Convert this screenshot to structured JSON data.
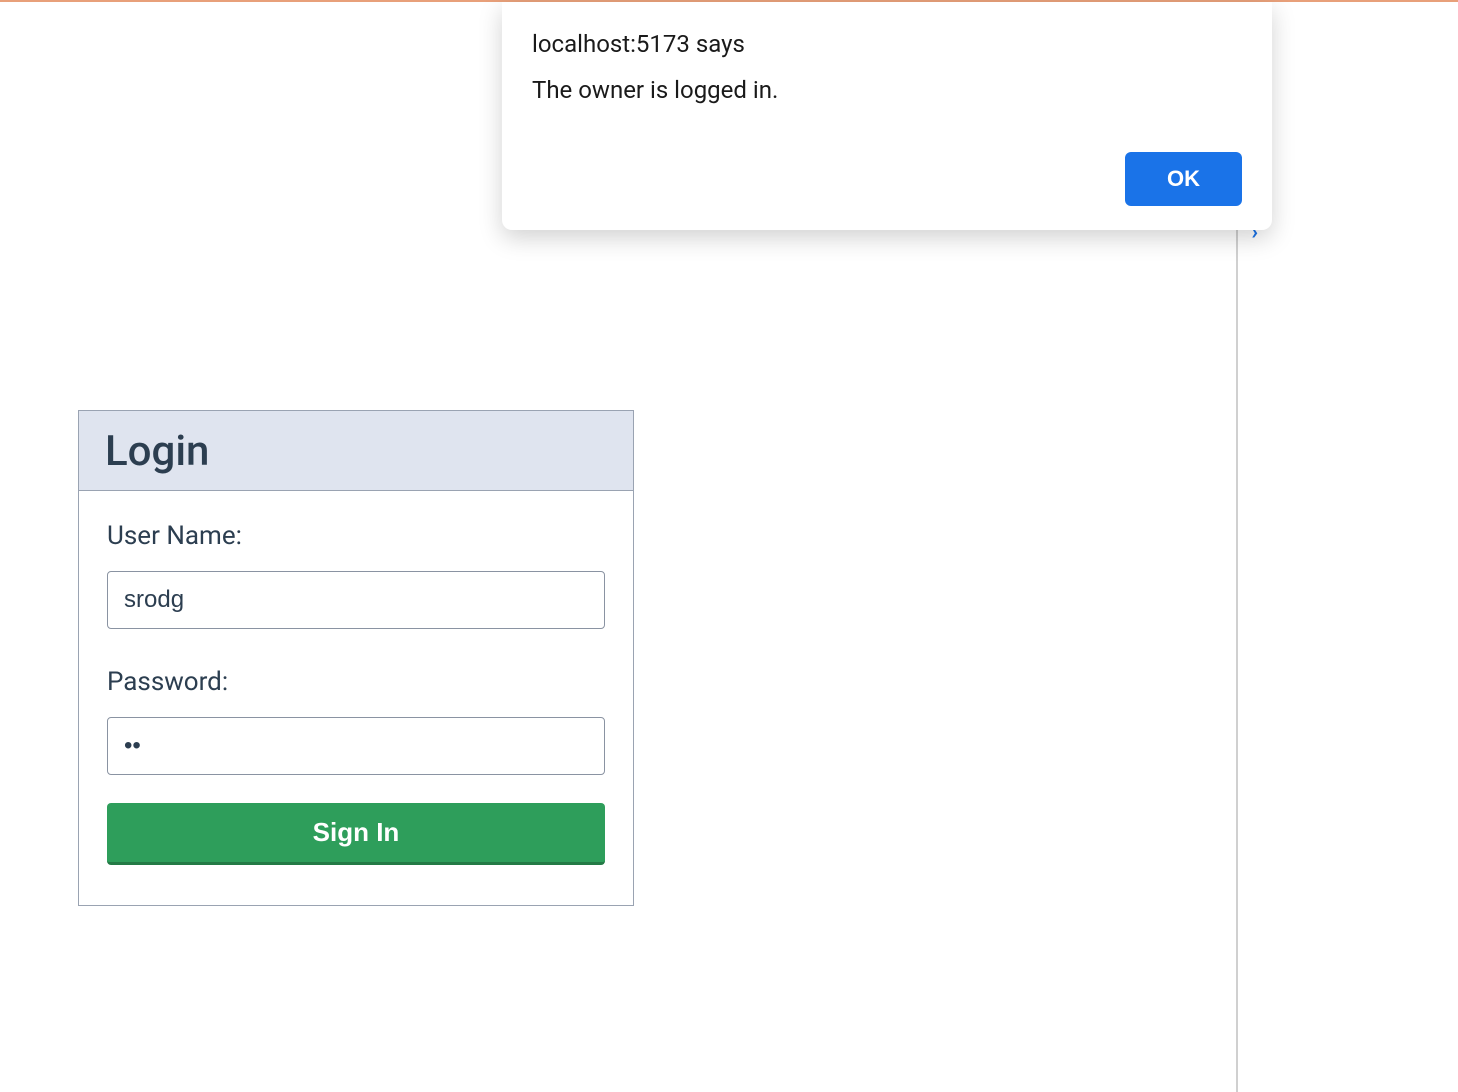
{
  "alert": {
    "origin": "localhost:5173 says",
    "message": "The owner is logged in.",
    "ok_label": "OK"
  },
  "login": {
    "title": "Login",
    "username_label": "User Name:",
    "username_value": "srodg",
    "password_label": "Password:",
    "password_value": "ab",
    "signin_label": "Sign In"
  }
}
